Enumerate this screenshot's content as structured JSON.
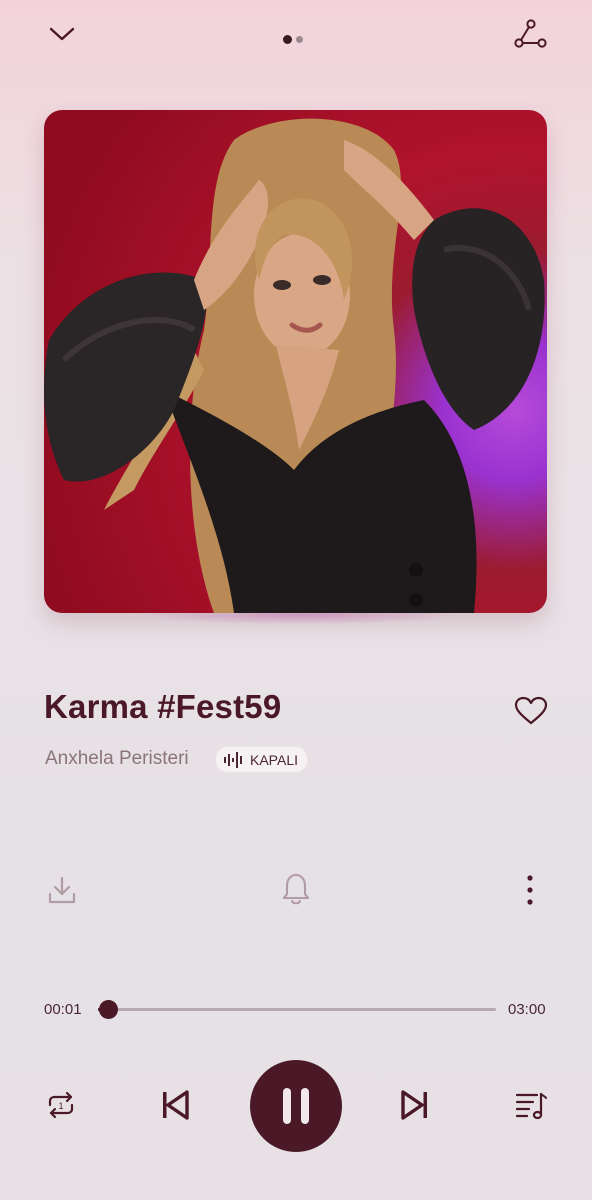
{
  "top_bar": {
    "collapse_icon": "chevron-down-icon",
    "pager": {
      "pages": 2,
      "current": 1
    },
    "share_icon": "share-icon"
  },
  "artwork": {
    "description_icon": "album-cover-image"
  },
  "song": {
    "title": "Karma #Fest59",
    "artist": "Anxhela Peristeri",
    "quality_label": "KAPALI",
    "liked": false
  },
  "actions": {
    "download_icon": "download-icon",
    "alarm_icon": "bell-icon",
    "more_icon": "more-vertical-icon"
  },
  "progress": {
    "current_time": "00:01",
    "total_time": "03:00",
    "fraction": 0.006
  },
  "controls": {
    "repeat_icon": "repeat-one-icon",
    "prev_icon": "skip-previous-icon",
    "play_state": "playing",
    "next_icon": "skip-next-icon",
    "queue_icon": "queue-music-icon"
  },
  "colors": {
    "accent": "#4a1826",
    "secondary_text": "#8b7479",
    "background_top": "#f3d3da",
    "background_bottom": "#e7e1e6"
  }
}
